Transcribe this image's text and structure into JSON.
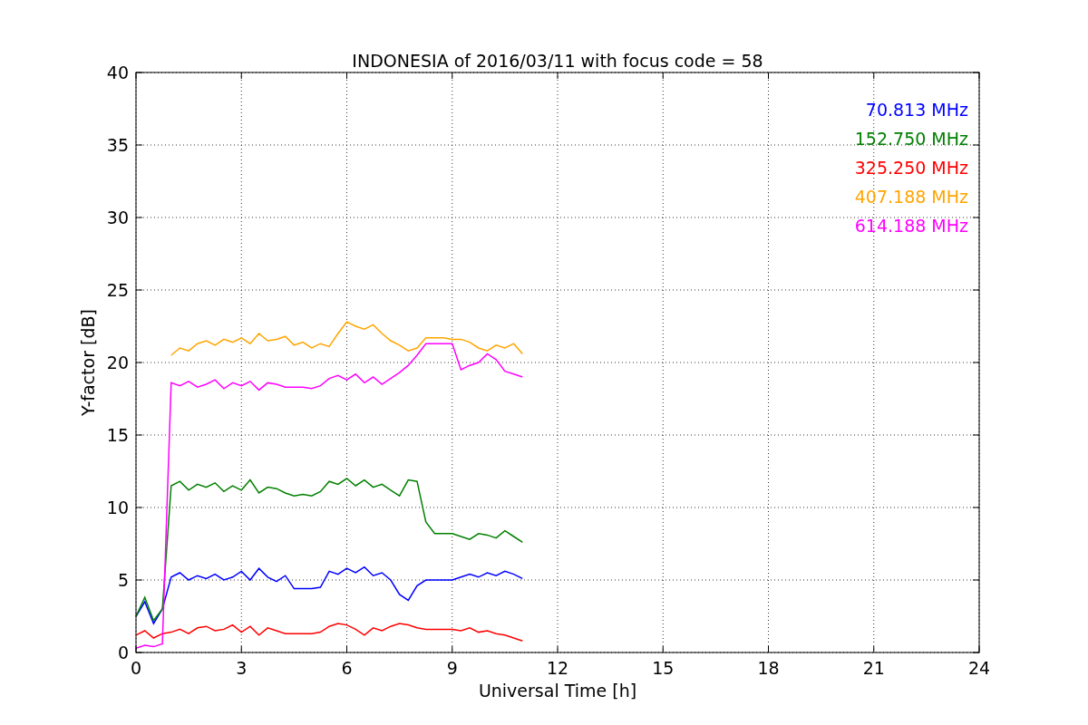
{
  "chart_data": {
    "type": "line",
    "title": "INDONESIA of 2016/03/11 with focus code = 58",
    "xlabel": "Universal Time [h]",
    "ylabel": "Y-factor [dB]",
    "xlim": [
      0,
      24
    ],
    "ylim": [
      0,
      40
    ],
    "xticks": [
      0,
      3,
      6,
      9,
      12,
      15,
      18,
      21,
      24
    ],
    "yticks": [
      0,
      5,
      10,
      15,
      20,
      25,
      30,
      35,
      40
    ],
    "grid": true,
    "x": [
      0,
      0.25,
      0.5,
      0.75,
      1,
      1.25,
      1.5,
      1.75,
      2,
      2.25,
      2.5,
      2.75,
      3,
      3.25,
      3.5,
      3.75,
      4,
      4.25,
      4.5,
      4.75,
      5,
      5.25,
      5.5,
      5.75,
      6,
      6.25,
      6.5,
      6.75,
      7,
      7.25,
      7.5,
      7.75,
      8,
      8.25,
      8.5,
      8.75,
      9,
      9.25,
      9.5,
      9.75,
      10,
      10.25,
      10.5,
      10.75,
      11
    ],
    "series": [
      {
        "name": "70.813 MHz",
        "color": "#0000ff",
        "values": [
          2.5,
          3.5,
          2.0,
          3.0,
          5.2,
          5.5,
          5.0,
          5.3,
          5.1,
          5.4,
          5.0,
          5.2,
          5.6,
          5.0,
          5.8,
          5.2,
          4.9,
          5.3,
          4.4,
          4.4,
          4.4,
          4.5,
          5.6,
          5.4,
          5.8,
          5.5,
          5.9,
          5.3,
          5.5,
          5.0,
          4.0,
          3.6,
          4.6,
          5.0,
          5.0,
          5.0,
          5.0,
          5.2,
          5.4,
          5.2,
          5.5,
          5.3,
          5.6,
          5.4,
          5.1
        ]
      },
      {
        "name": "152.750 MHz",
        "color": "#008000",
        "values": [
          2.5,
          3.8,
          2.2,
          3.0,
          11.5,
          11.8,
          11.2,
          11.6,
          11.4,
          11.7,
          11.1,
          11.5,
          11.2,
          11.9,
          11.0,
          11.4,
          11.3,
          11.0,
          10.8,
          10.9,
          10.8,
          11.1,
          11.8,
          11.6,
          12.0,
          11.5,
          11.9,
          11.4,
          11.6,
          11.2,
          10.8,
          11.9,
          11.8,
          9.0,
          8.2,
          8.2,
          8.2,
          8.0,
          7.8,
          8.2,
          8.1,
          7.9,
          8.4,
          8.0,
          7.6
        ]
      },
      {
        "name": "325.250 MHz",
        "color": "#ff0000",
        "values": [
          1.2,
          1.5,
          1.0,
          1.3,
          1.4,
          1.6,
          1.3,
          1.7,
          1.8,
          1.5,
          1.6,
          1.9,
          1.4,
          1.8,
          1.2,
          1.7,
          1.5,
          1.3,
          1.3,
          1.3,
          1.3,
          1.4,
          1.8,
          2.0,
          1.9,
          1.6,
          1.2,
          1.7,
          1.5,
          1.8,
          2.0,
          1.9,
          1.7,
          1.6,
          1.6,
          1.6,
          1.6,
          1.5,
          1.7,
          1.4,
          1.5,
          1.3,
          1.2,
          1.0,
          0.8
        ]
      },
      {
        "name": "407.188 MHz",
        "color": "#ffa500",
        "values": [
          null,
          null,
          null,
          null,
          20.5,
          21.0,
          20.8,
          21.3,
          21.5,
          21.2,
          21.6,
          21.4,
          21.7,
          21.3,
          22.0,
          21.5,
          21.6,
          21.8,
          21.2,
          21.4,
          21.0,
          21.3,
          21.1,
          22.0,
          22.8,
          22.5,
          22.3,
          22.6,
          22.0,
          21.5,
          21.2,
          20.8,
          21.0,
          21.7,
          21.7,
          21.7,
          21.6,
          21.6,
          21.4,
          21.0,
          20.8,
          21.2,
          21.0,
          21.3,
          20.6
        ]
      },
      {
        "name": "614.188 MHz",
        "color": "#ff00ff",
        "values": [
          0.3,
          0.5,
          0.4,
          0.6,
          18.6,
          18.4,
          18.7,
          18.3,
          18.5,
          18.8,
          18.2,
          18.6,
          18.4,
          18.7,
          18.1,
          18.6,
          18.5,
          18.3,
          18.3,
          18.3,
          18.2,
          18.4,
          18.9,
          19.1,
          18.8,
          19.2,
          18.6,
          19.0,
          18.5,
          18.9,
          19.3,
          19.8,
          20.5,
          21.3,
          21.3,
          21.3,
          21.3,
          19.5,
          19.8,
          20.0,
          20.6,
          20.2,
          19.4,
          19.2,
          19.0
        ]
      }
    ]
  }
}
